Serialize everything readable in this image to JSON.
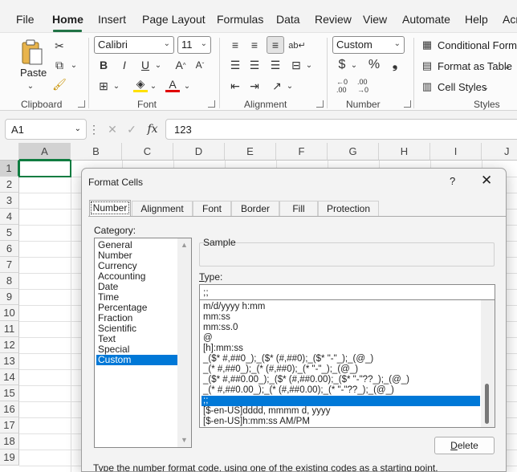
{
  "menu": [
    "File",
    "Home",
    "Insert",
    "Page Layout",
    "Formulas",
    "Data",
    "Review",
    "View",
    "Automate",
    "Help",
    "Acr"
  ],
  "ribbon": {
    "paste_label": "Paste",
    "font_name": "Calibri",
    "font_size": "11",
    "number_format": "Custom",
    "conditional_formatting": "Conditional Forma",
    "format_as_table": "Format as Table",
    "cell_styles": "Cell Styles",
    "groups": {
      "clipboard": "Clipboard",
      "font": "Font",
      "alignment": "Alignment",
      "number": "Number",
      "styles": "Styles"
    },
    "bold": "B",
    "italic": "I",
    "underline": "U",
    "currency_symbol": "$",
    "percent_symbol": "%",
    "comma_symbol": "͉"
  },
  "formula_bar": {
    "name_box": "A1",
    "fx": "fx",
    "value": "123"
  },
  "grid": {
    "columns": [
      "A",
      "B",
      "C",
      "D",
      "E",
      "F",
      "G",
      "H",
      "I",
      "J"
    ],
    "rows": [
      "1",
      "2",
      "3",
      "4",
      "5",
      "6",
      "7",
      "8",
      "9",
      "10",
      "11",
      "12",
      "13",
      "14",
      "15",
      "16",
      "17",
      "18",
      "19"
    ]
  },
  "dialog": {
    "title": "Format Cells",
    "help": "?",
    "close": "✕",
    "tabs": [
      "Number",
      "Alignment",
      "Font",
      "Border",
      "Fill",
      "Protection"
    ],
    "category_label": "Category:",
    "categories": [
      "General",
      "Number",
      "Currency",
      "Accounting",
      "Date",
      "Time",
      "Percentage",
      "Fraction",
      "Scientific",
      "Text",
      "Special",
      "Custom"
    ],
    "selected_category": "Custom",
    "sample_label": "Sample",
    "type_label_first": "T",
    "type_label_rest": "ype:",
    "type_value": ";;",
    "formats": [
      "m/d/yyyy h:mm",
      "mm:ss",
      "mm:ss.0",
      "@",
      "[h]:mm:ss",
      "_($* #,##0_);_($* (#,##0);_($* \"-\"_);_(@_)",
      "_(* #,##0_);_(* (#,##0);_(* \"-\"_);_(@_)",
      "_($* #,##0.00_);_($* (#,##0.00);_($* \"-\"??_);_(@_)",
      "_(* #,##0.00_);_(* (#,##0.00);_(* \"-\"??_);_(@_)",
      ";;",
      "[$-en-US]dddd, mmmm d, yyyy",
      "[$-en-US]h:mm:ss AM/PM"
    ],
    "selected_format": ";;",
    "delete_first": "D",
    "delete_rest": "elete",
    "hint": "Type the number format code, using one of the existing codes as a starting point."
  }
}
